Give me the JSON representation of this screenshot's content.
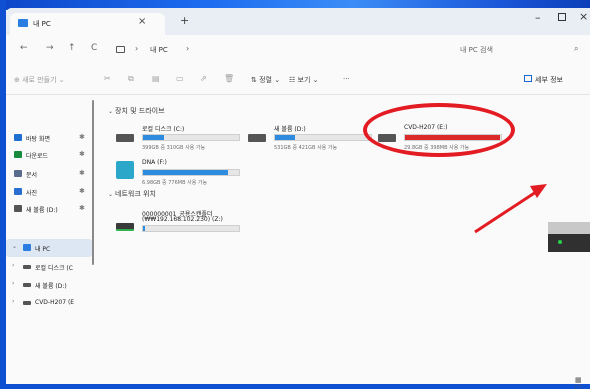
{
  "window": {
    "tab_title": "내 PC",
    "tab_close": "×",
    "new_tab": "+",
    "minimize": "–",
    "close": "×"
  },
  "nav": {
    "back": "←",
    "forward": "→",
    "up": "↑",
    "refresh": "C",
    "address_sep": "›",
    "address_path": "내 PC",
    "search_placeholder": "내 PC 검색",
    "search_icon": "⌕"
  },
  "toolbar": {
    "new_label": "⊕ 새로 만들기 ⌄",
    "sort_label": "⇅ 정렬 ⌄",
    "view_label": "☷ 보기 ⌄",
    "more_label": "···",
    "details_label": "세부 정보",
    "icons": {
      "cut": "✂",
      "copy": "⧉",
      "paste": "▤",
      "rename": "▭",
      "share": "⇗",
      "delete": "🗑"
    }
  },
  "sidebar": {
    "items": [
      {
        "label": "바탕 화면",
        "pin": "✱",
        "color": "#1f6fd1"
      },
      {
        "label": "다운로드",
        "pin": "✱",
        "color": "#1a8a3e"
      },
      {
        "label": "문서",
        "pin": "✱",
        "color": "#5a6b8c"
      },
      {
        "label": "사진",
        "pin": "✱",
        "color": "#2b6ed1"
      },
      {
        "label": "새 볼륨 (D:)",
        "pin": "✱",
        "color": "#555555"
      }
    ],
    "tree": [
      {
        "label": "내 PC",
        "chev": "⌄"
      },
      {
        "label": "로컬 디스크 (C",
        "chev": "›"
      },
      {
        "label": "새 볼륨 (D:)",
        "chev": "›"
      },
      {
        "label": "CVD-H207 (E",
        "chev": "›"
      }
    ]
  },
  "content": {
    "groups": {
      "devices": "장치 및 드라이브",
      "network": "네트워크 위치"
    },
    "drives": [
      {
        "name": "로컬 디스크 (C:)",
        "free": "399GB 중 310GB 사용 가능",
        "used_fraction": 0.22,
        "color": "#2d8be0"
      },
      {
        "name": "새 볼륨 (D:)",
        "free": "531GB 중 421GB 사용 가능",
        "used_fraction": 0.21,
        "color": "#2d8be0"
      },
      {
        "name": "CVD-H207 (E:)",
        "free": "29.8GB 중 398MB 사용 가능",
        "used_fraction": 0.99,
        "color": "#da2a2a"
      },
      {
        "name": "DNA (F:)",
        "free": "6.98GB 중 776MB 사용 가능",
        "used_fraction": 0.89,
        "color": "#2d8be0"
      }
    ],
    "network": {
      "name": "000000001_공용스캔폴더",
      "path": "(₩₩192.168.102.230) (Z:)",
      "used_fraction": 0.02,
      "color": "#2d8be0"
    }
  },
  "accent": {
    "callout": "#e31b23"
  },
  "status_icon": "▦ ☐"
}
